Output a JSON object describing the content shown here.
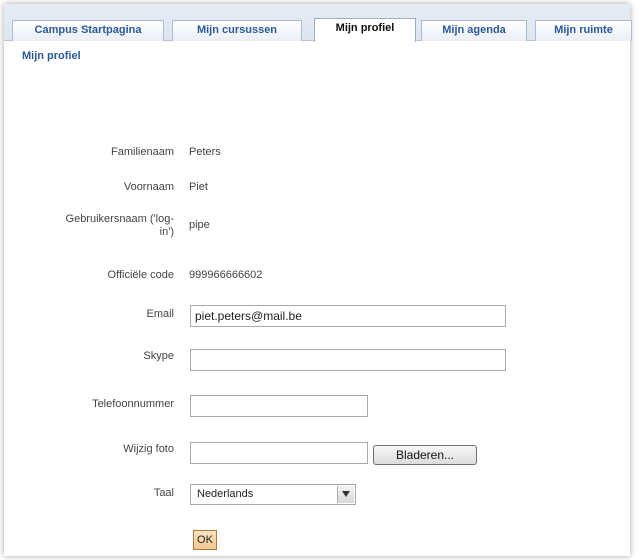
{
  "tabs": [
    {
      "label": "Campus Startpagina"
    },
    {
      "label": "Mijn cursussen"
    },
    {
      "label": "Mijn profiel"
    },
    {
      "label": "Mijn agenda"
    },
    {
      "label": "Mijn ruimte"
    }
  ],
  "breadcrumb": "Mijn profiel",
  "profile": {
    "lastname_label": "Familienaam",
    "lastname": "Peters",
    "firstname_label": "Voornaam",
    "firstname": "Piet",
    "username_label_line1": "Gebruikersnaam ('log-",
    "username_label_line2": "in')",
    "username": "pipe",
    "officialcode_label": "Officiële code",
    "officialcode": "999966666602",
    "email_label": "Email",
    "email": "piet.peters@mail.be",
    "skype_label": "Skype",
    "skype": "",
    "phone_label": "Telefoonnummer",
    "phone": "",
    "photo_label": "Wijzig foto",
    "photo": "",
    "browse_label": "Bladeren...",
    "language_label": "Taal",
    "language": "Nederlands",
    "ok_label": "OK"
  },
  "colors": {
    "tab_text": "#2b5a9a",
    "ok_button": "#f1c88f"
  }
}
